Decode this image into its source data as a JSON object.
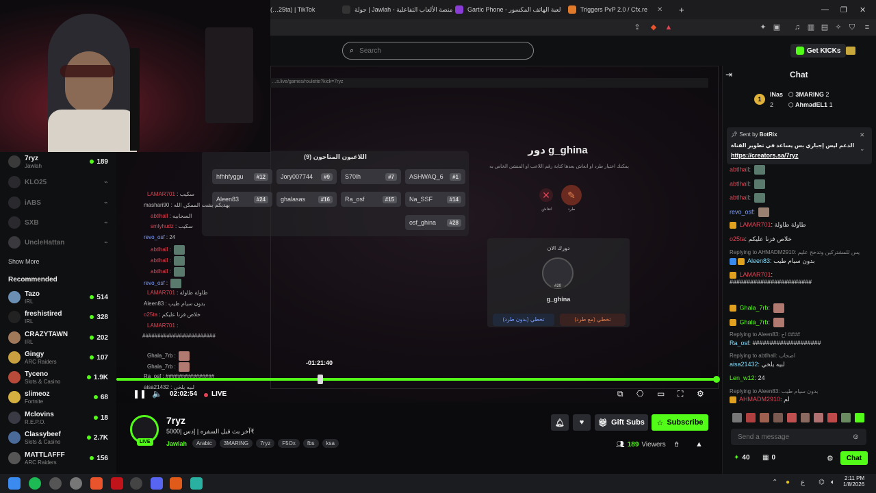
{
  "browser": {
    "tabs": [
      {
        "label": "(…25ta) | TikTok"
      },
      {
        "label": "جولة | Jawlah - منصة الألعاب التفاعلية"
      },
      {
        "label": "Gartic Phone - لعبة الهاتف المكسور"
      },
      {
        "label": "Triggers PvP 2.0 / Cfx.re"
      }
    ],
    "new_tab": "+"
  },
  "header": {
    "search_placeholder": "Search",
    "get_kicks_label": "Get KICKs"
  },
  "sidebar": {
    "following": [
      {
        "name": "7ryz",
        "category": "Jawlah",
        "viewers": "189",
        "live": true
      },
      {
        "name": "KLO25",
        "live": false
      },
      {
        "name": "iABS",
        "live": false
      },
      {
        "name": "SXB",
        "live": false
      },
      {
        "name": "UncleHattan",
        "live": false
      }
    ],
    "show_more_label": "Show More",
    "recommended_title": "Recommended",
    "recommended": [
      {
        "name": "Tazo",
        "category": "IRL",
        "viewers": "514"
      },
      {
        "name": "freshistired",
        "category": "IRL",
        "viewers": "328"
      },
      {
        "name": "CRAZYTAWN",
        "category": "IRL",
        "viewers": "202"
      },
      {
        "name": "Gingy",
        "category": "ARC Raiders",
        "viewers": "107"
      },
      {
        "name": "Tyceno",
        "category": "Slots & Casino",
        "viewers": "1.9K"
      },
      {
        "name": "slimeoz",
        "category": "Fortnite",
        "viewers": "68"
      },
      {
        "name": "Mclovins",
        "category": "R.E.P.O.",
        "viewers": "18"
      },
      {
        "name": "Classybeef",
        "category": "Slots & Casino",
        "viewers": "2.7K"
      },
      {
        "name": "MATTLAFFF",
        "category": "ARC Raiders",
        "viewers": "156"
      }
    ]
  },
  "video": {
    "inner_url": "…s.live/games/roulette?kick=7ryz",
    "game_title": "دور g_ghina",
    "game_desc": "يمكنك اختيار طرد او انعاش بعدها كتابة رقم اللاعب او المنشن الخاص به",
    "kick_label": "طرد",
    "revive_label": "انعاش",
    "current_turn": "دورك الان",
    "current_player": "g_ghina",
    "current_player_num": "#20",
    "skip_btn": "تخطي (بدون طرد)",
    "skip_kick_btn": "تخطي (مع طرد)",
    "players_title": "اللاعبون المتاحون (9)",
    "players": [
      {
        "name": "hfhhfyggu",
        "num": "#12"
      },
      {
        "name": "Jory007744",
        "num": "#9"
      },
      {
        "name": "S70lh",
        "num": "#7"
      },
      {
        "name": "ASHWAQ_6",
        "num": "#1"
      },
      {
        "name": "Aleen83",
        "num": "#24"
      },
      {
        "name": "ghalasas",
        "num": "#16"
      },
      {
        "name": "Ra_osf",
        "num": "#15"
      },
      {
        "name": "Na_SSF",
        "num": "#14"
      },
      {
        "name": "osf_ghina",
        "num": "#28"
      }
    ],
    "overlay_chat": [
      {
        "user": "LAMAR701",
        "text": "سكيب"
      },
      {
        "user": "mashari90",
        "text": "يهديكم يشت الممكن الله"
      },
      {
        "user": "abtlhall",
        "text": "السحابيه"
      },
      {
        "user": "smlyhudz",
        "text": "سكيب"
      },
      {
        "user": "revo_osf",
        "text": "24"
      },
      {
        "user": "abtlhall",
        "text": ""
      },
      {
        "user": "abtlhall",
        "text": ""
      },
      {
        "user": "abtlhall",
        "text": ""
      },
      {
        "user": "revo_osf",
        "text": ""
      },
      {
        "user": "LAMAR701",
        "text": "طاولة طاولة"
      },
      {
        "user": "Aleen83",
        "text": "بدون سيام طيب"
      },
      {
        "user": "o25ta",
        "text": "خلاص فزنا عليكم"
      },
      {
        "user": "LAMAR701",
        "text": ""
      },
      {
        "user": "",
        "text": "########################"
      },
      {
        "user": "Ghala_7rb",
        "text": ""
      },
      {
        "user": "Ghala_7rb",
        "text": ""
      },
      {
        "user": "Ra_osf",
        "text": "################"
      },
      {
        "user": "aisa21432",
        "text": "لبيه يلخي"
      }
    ],
    "seek_tooltip": "-01:21:40",
    "elapsed": "02:02:54",
    "live_label": "LIVE"
  },
  "stream": {
    "streamer": "7ryz",
    "live_badge": "LIVE",
    "title": "آخر بث قبل السفره | إدس |5000₹",
    "category": "Jawlah",
    "tags": [
      "Arabic",
      "3MARING",
      "7ryz",
      "F5Ox",
      "fbs",
      "ksa"
    ],
    "gift_subs_label": "Gift Subs",
    "subscribe_label": "Subscribe",
    "viewers": "189",
    "viewers_label": "Viewers"
  },
  "chat": {
    "title": "Chat",
    "leaderboard": [
      {
        "rank": "1",
        "name": "INas",
        "count": "2"
      },
      {
        "name": "3MARING",
        "count": "2"
      },
      {
        "name": "AhmadEL1",
        "count": "1"
      }
    ],
    "pinned_sender_prefix": "Sent by",
    "pinned_sender": "BotRix",
    "pinned_text": "الدعم ليس إجباري بس يساعد في تطوير القناة",
    "pinned_link": "https://creators.sa/7ryz",
    "messages": [
      {
        "user": "abtlhall",
        "text": ""
      },
      {
        "user": "abtlhall",
        "text": ""
      },
      {
        "user": "abtlhall",
        "text": ""
      },
      {
        "user": "revo_osf",
        "text": ""
      },
      {
        "user": "LAMAR701",
        "text": "طاولة طاولة"
      },
      {
        "user": "o25ta",
        "text": "خلاص فزنا عليكم"
      },
      {
        "reply": "Replying to AHMADM2910: يس للمشتركين وتدخح عليم",
        "user": "Aleen83",
        "text": "بدون سيام طيب"
      },
      {
        "user": "LAMAR701",
        "text": "########################"
      },
      {
        "user": "Ghala_7rb",
        "text": ""
      },
      {
        "user": "Ghala_7rb",
        "text": ""
      },
      {
        "reply": "Replying to Aleen83: اح ####",
        "user": "Ra_osf",
        "text": "####################"
      },
      {
        "reply": "Replying to abtlhall: اصحاب",
        "user": "aisa21432",
        "text": "لبيه يلخي"
      },
      {
        "user": "Len_w12",
        "text": "24"
      },
      {
        "reply": "Replying to Aleen83: بدون سيام طيب",
        "user": "AHMADM2910",
        "text": "لم"
      }
    ],
    "message_placeholder": "Send a message",
    "points": "40",
    "gifts": "0",
    "send_label": "Chat"
  },
  "taskbar": {
    "time": "2:11 PM",
    "date": "1/8/2026",
    "lang": "ع"
  },
  "colors": {
    "kick_green": "#53fc18",
    "live_red": "#e04455"
  }
}
